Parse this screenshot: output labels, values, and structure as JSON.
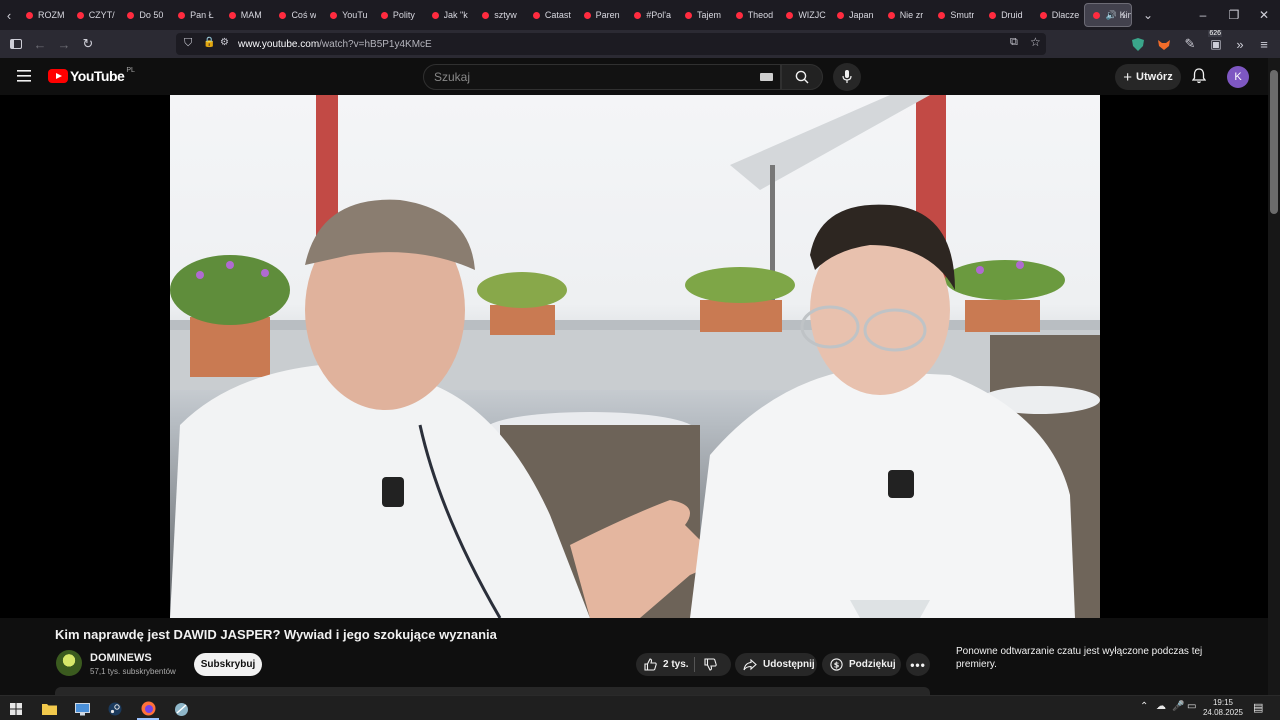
{
  "browser": {
    "tabs": [
      {
        "label": "ROZM"
      },
      {
        "label": "CZYT/"
      },
      {
        "label": "Do 50"
      },
      {
        "label": "Pan Ł"
      },
      {
        "label": "MAM"
      },
      {
        "label": "Coś w"
      },
      {
        "label": "YouTu"
      },
      {
        "label": "Polity"
      },
      {
        "label": "Jak \"k"
      },
      {
        "label": "sztyw"
      },
      {
        "label": "Catast"
      },
      {
        "label": "Paren"
      },
      {
        "label": "#Pol'a"
      },
      {
        "label": "Tajem"
      },
      {
        "label": "Theod"
      },
      {
        "label": "WIZJC"
      },
      {
        "label": "Japan"
      },
      {
        "label": "Nie zr"
      },
      {
        "label": "Smutr"
      },
      {
        "label": "Druid"
      },
      {
        "label": "Dlacze"
      }
    ],
    "active_tab": {
      "label": "Kim"
    },
    "url_domain": "www.youtube.com",
    "url_path": "/watch?v=hB5P1y4KMcE",
    "extension_badge": "626"
  },
  "youtube": {
    "logo_text": "YouTube",
    "country_code": "PL",
    "search_placeholder": "Szukaj",
    "create_label": "Utwórz",
    "avatar_letter": "K"
  },
  "video": {
    "title": "Kim naprawdę jest DAWID JASPER? Wywiad i jego szokujące wyznania",
    "channel_name": "DOMINEWS",
    "channel_subs": "57,1 tys. subskrybentów",
    "subscribe_label": "Subskrybuj",
    "likes": "2 tys.",
    "share_label": "Udostępnij",
    "thanks_label": "Podziękuj",
    "chat_note": "Ponowne odtwarzanie czatu jest wyłączone podczas tej premiery."
  },
  "taskbar": {
    "time": "19:15",
    "date": "24.08.2025"
  },
  "colors": {
    "brand_red": "#ff0000",
    "tab_favicon": "#ff2b3f",
    "avatar_purple": "#7e57c2",
    "yt_background": "#0f0f0f"
  }
}
